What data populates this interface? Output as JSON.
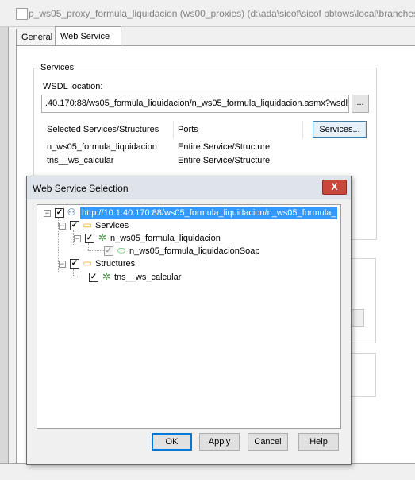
{
  "window": {
    "title": "p_ws05_proxy_formula_liquidacion (ws00_proxies) (d:\\ada\\sicof\\sicof pbtows\\local\\branches"
  },
  "tabs": [
    {
      "label": "General"
    },
    {
      "label": "Web Service"
    }
  ],
  "services_group": {
    "label": "Services",
    "wsdl_label": "WSDL location:",
    "wsdl_value": ".40.170:88/ws05_formula_liquidacion/n_ws05_formula_liquidacion.asmx?wsdl",
    "browse_label": "...",
    "columns": [
      "Selected Services/Structures",
      "Ports"
    ],
    "services_button": "Services...",
    "rows": [
      {
        "name": "n_ws05_formula_liquidacion",
        "port": "Entire Service/Structure"
      },
      {
        "name": "tns__ws_calcular",
        "port": "Entire Service/Structure"
      }
    ]
  },
  "dialog": {
    "title": "Web Service Selection",
    "close_label": "X",
    "tree": {
      "root": "http://10.1.40.170:88/ws05_formula_liquidacion/n_ws05_formula_",
      "services_folder": "Services",
      "service": "n_ws05_formula_liquidacion",
      "port": "n_ws05_formula_liquidacionSoap",
      "structures_folder": "Structures",
      "structure": "tns__ws_calcular"
    },
    "buttons": {
      "ok": "OK",
      "apply": "Apply",
      "cancel": "Cancel",
      "help": "Help"
    }
  }
}
